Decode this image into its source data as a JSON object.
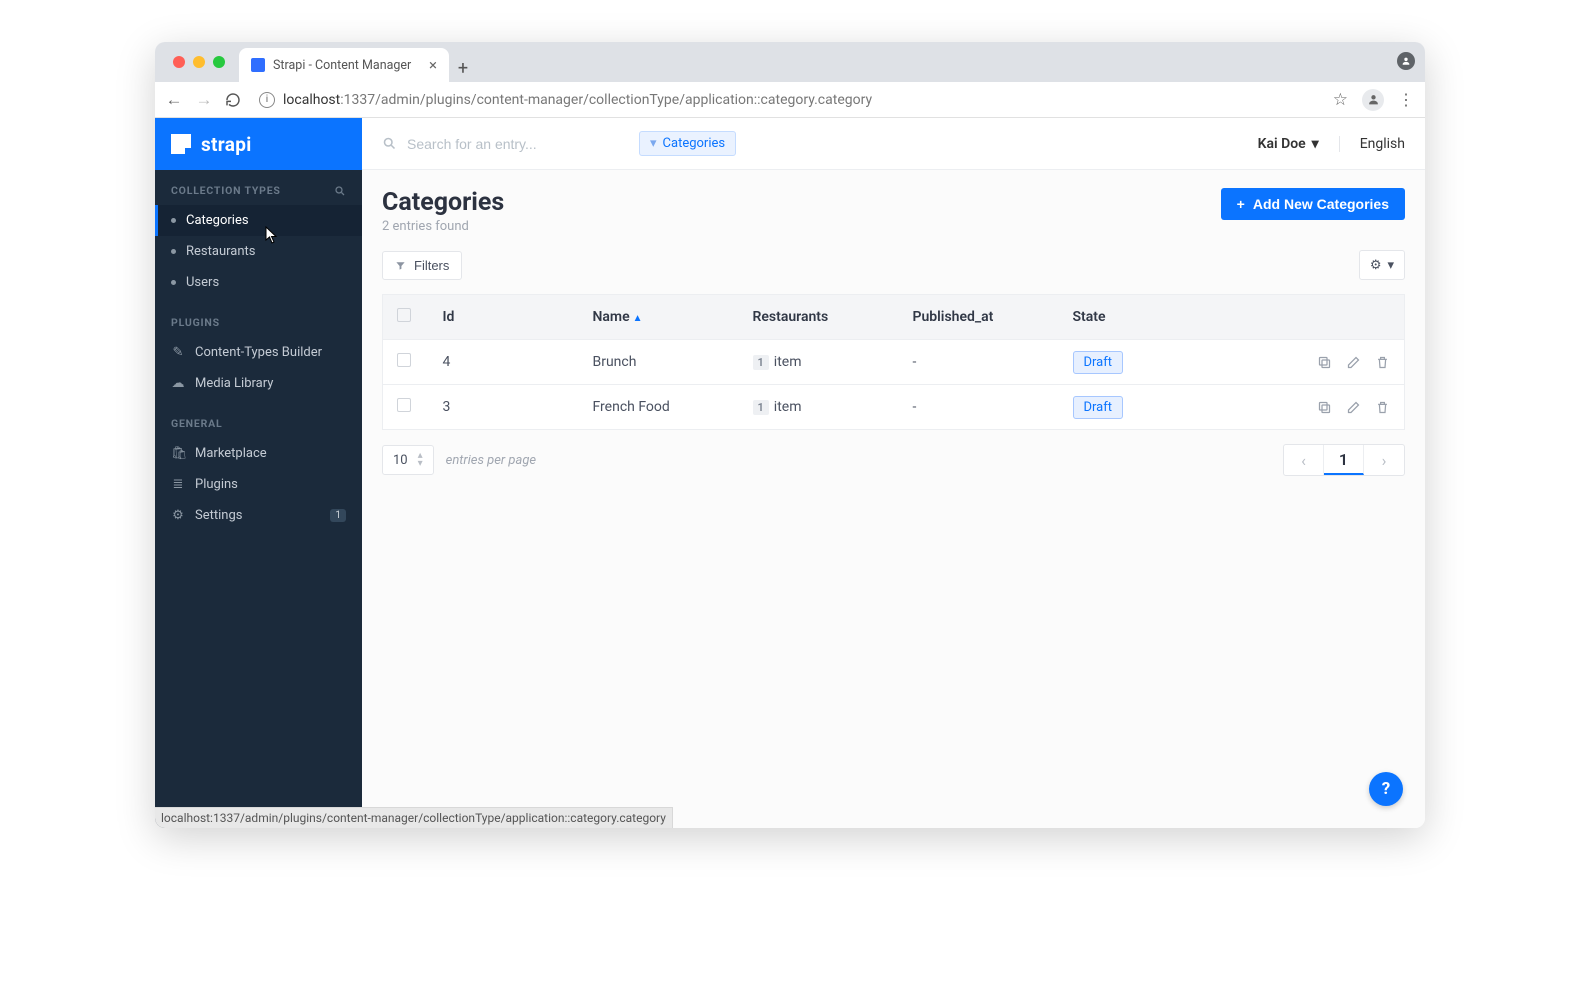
{
  "browser": {
    "tab_title": "Strapi - Content Manager",
    "url_host": "localhost",
    "url_port": ":1337",
    "url_path": "/admin/plugins/content-manager/collectionType/application::category.category",
    "status_url": "localhost:1337/admin/plugins/content-manager/collectionType/application::category.category"
  },
  "brand": "strapi",
  "sidebar": {
    "sections": {
      "collection_header": "COLLECTION TYPES",
      "plugins_header": "PLUGINS",
      "general_header": "GENERAL"
    },
    "collection": [
      {
        "label": "Categories"
      },
      {
        "label": "Restaurants"
      },
      {
        "label": "Users"
      }
    ],
    "plugins": [
      {
        "label": "Content-Types Builder"
      },
      {
        "label": "Media Library"
      }
    ],
    "general": [
      {
        "label": "Marketplace"
      },
      {
        "label": "Plugins"
      },
      {
        "label": "Settings",
        "badge": "1"
      }
    ]
  },
  "topbar": {
    "search_placeholder": "Search for an entry...",
    "chip_label": "Categories",
    "user": "Kai Doe",
    "language": "English"
  },
  "page": {
    "title": "Categories",
    "subtitle": "2 entries found",
    "add_button": "Add New Categories",
    "filters_label": "Filters"
  },
  "table": {
    "columns": {
      "id": "Id",
      "name": "Name",
      "restaurants": "Restaurants",
      "published": "Published_at",
      "state": "State"
    },
    "rows": [
      {
        "id": "4",
        "name": "Brunch",
        "rest_count": "1",
        "rest_word": "item",
        "published": "-",
        "state": "Draft"
      },
      {
        "id": "3",
        "name": "French Food",
        "rest_count": "1",
        "rest_word": "item",
        "published": "-",
        "state": "Draft"
      }
    ]
  },
  "pagination": {
    "per_page": "10",
    "per_page_label": "entries per page",
    "current": "1"
  }
}
